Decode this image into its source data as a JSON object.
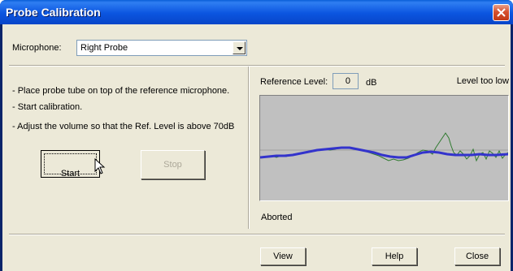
{
  "window": {
    "title": "Probe Calibration",
    "close_icon": "close-icon"
  },
  "microphone": {
    "label": "Microphone:",
    "selected": "Right Probe"
  },
  "instructions": [
    "- Place probe tube on top of the reference microphone.",
    "- Start calibration.",
    "- Adjust the volume so that the Ref. Level is above 70dB"
  ],
  "buttons": {
    "start": "Start",
    "start_mnemonic": "S",
    "start_rest": "tart",
    "stop": "Stop",
    "view": "View",
    "help": "Help",
    "close": "Close"
  },
  "reference": {
    "label": "Reference Level:",
    "value": "0",
    "unit": "dB",
    "status": "Level too low"
  },
  "status": "Aborted",
  "colors": {
    "titlebar": "#0b55e0",
    "dialog_bg": "#ece9d8",
    "graph_bg": "#c0c0c0",
    "graph_smooth_line": "#3333cc",
    "graph_raw_line": "#2f7a2f",
    "graph_ref_line": "#a0a0a0",
    "close_button": "#d6502e"
  }
}
